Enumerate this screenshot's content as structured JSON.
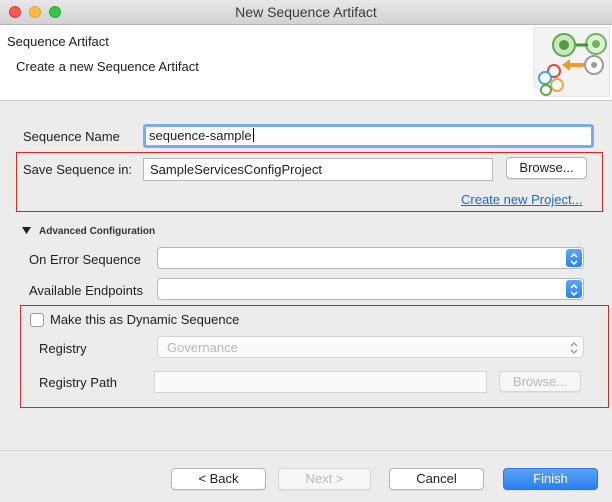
{
  "window": {
    "title": "New Sequence Artifact"
  },
  "header": {
    "title": "Sequence Artifact",
    "description": "Create a new Sequence Artifact"
  },
  "form": {
    "sequence_name_label": "Sequence Name",
    "sequence_name_value": "sequence-sample",
    "save_in_label": "Save Sequence in:",
    "save_in_value": "SampleServicesConfigProject",
    "browse_label": "Browse...",
    "create_project_link": "Create new Project...",
    "advanced_label": "Advanced Configuration",
    "on_error_label": "On Error Sequence",
    "on_error_value": "",
    "endpoints_label": "Available Endpoints",
    "endpoints_value": "",
    "dynamic_label": "Make this as Dynamic Sequence",
    "dynamic_checked": false,
    "registry_label": "Registry",
    "registry_value": "Governance",
    "registry_path_label": "Registry Path",
    "registry_path_value": "",
    "registry_browse_label": "Browse..."
  },
  "footer": {
    "back_label": "< Back",
    "next_label": "Next >",
    "cancel_label": "Cancel",
    "finish_label": "Finish"
  },
  "colors": {
    "accent": "#2a7ff0",
    "highlight_border": "#e02222",
    "link": "#1a67d2"
  }
}
